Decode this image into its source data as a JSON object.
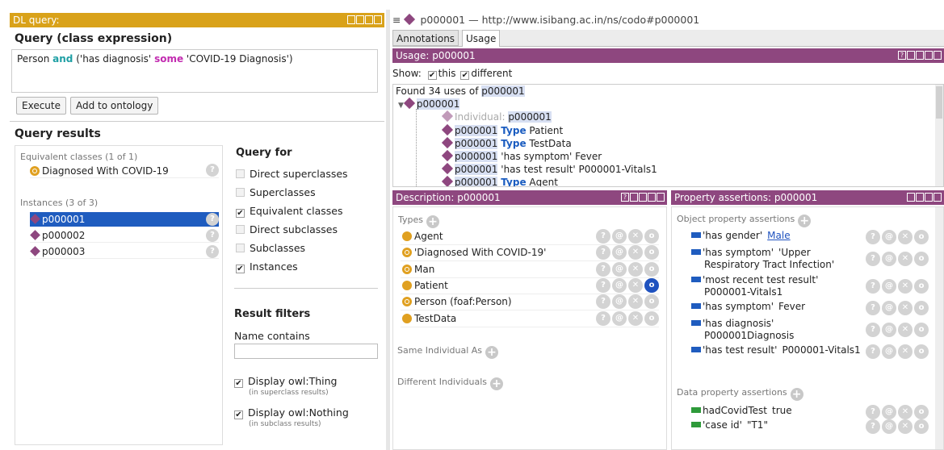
{
  "dl_query": {
    "title": "DL query:",
    "section_query": "Query (class expression)",
    "expr": {
      "a": "Person",
      "b": "and",
      "c": "('has diagnosis'",
      "d": "some",
      "e": "'COVID-19 Diagnosis')"
    },
    "execute": "Execute",
    "add": "Add to ontology",
    "results": "Query results",
    "equiv_header": "Equivalent classes (1 of 1)",
    "equiv_item": "Diagnosed With COVID-19",
    "inst_header": "Instances (3 of 3)",
    "instances": [
      "p000001",
      "p000002",
      "p000003"
    ],
    "query_for": "Query for",
    "options": [
      {
        "label": "Direct superclasses",
        "checked": false
      },
      {
        "label": "Superclasses",
        "checked": false
      },
      {
        "label": "Equivalent classes",
        "checked": true
      },
      {
        "label": "Direct subclasses",
        "checked": false
      },
      {
        "label": "Subclasses",
        "checked": false
      },
      {
        "label": "Instances",
        "checked": true
      }
    ],
    "result_filters": "Result filters",
    "name_contains": "Name contains",
    "thing": "Display owl:Thing",
    "thing_sub": "(in superclass results)",
    "nothing": "Display owl:Nothing",
    "nothing_sub": "(in subclass results)"
  },
  "entity": {
    "title": "p000001 — http://www.isibang.ac.in/ns/codo#p000001",
    "tabs": [
      "Annotations",
      "Usage"
    ]
  },
  "usage": {
    "title": "Usage: p000001",
    "show": "Show:",
    "this": "this",
    "different": "different",
    "found_pre": "Found 34 uses of ",
    "found_id": "p000001",
    "root": "p000001",
    "ind_pre": "Individual:",
    "ind_id": "p000001",
    "rows": [
      {
        "id": "p000001",
        "kw": "Type",
        "rest": "Patient"
      },
      {
        "id": "p000001",
        "kw": "Type",
        "rest": "TestData"
      },
      {
        "id": "p000001",
        "kw": "",
        "rest": "'has symptom' Fever"
      },
      {
        "id": "p000001",
        "kw": "",
        "rest": "'has test result' P000001-Vitals1"
      },
      {
        "id": "p000001",
        "kw": "Type",
        "rest": "Agent"
      }
    ]
  },
  "description": {
    "title": "Description: p000001",
    "types": "Types",
    "type_items": [
      "Agent",
      "'Diagnosed With COVID-19'",
      "Man",
      "Patient",
      "Person (foaf:Person)",
      "TestData"
    ],
    "same": "Same Individual As",
    "different": "Different Individuals"
  },
  "props": {
    "title": "Property assertions: p000001",
    "obj": "Object property assertions",
    "obj_items": [
      {
        "p": "'has gender'",
        "v": "Male",
        "l2": ""
      },
      {
        "p": "'has symptom'",
        "v": "'Upper",
        "l2": "Respiratory Tract Infection'"
      },
      {
        "p": "'most recent test result'",
        "v": "",
        "l2": "P000001-Vitals1"
      },
      {
        "p": "'has symptom'",
        "v": "Fever",
        "l2": ""
      },
      {
        "p": "'has diagnosis'",
        "v": "",
        "l2": "P000001Diagnosis"
      },
      {
        "p": "'has test result'",
        "v": "P000001-Vitals1",
        "l2": ""
      }
    ],
    "data": "Data property assertions",
    "data_items": [
      {
        "p": "hadCovidTest",
        "v": "true"
      },
      {
        "p": "'case id'",
        "v": "\"T1\""
      }
    ]
  },
  "colors": {
    "orange": "#d9a21a",
    "purple": "#8e477f",
    "blue": "#1f52bf"
  }
}
